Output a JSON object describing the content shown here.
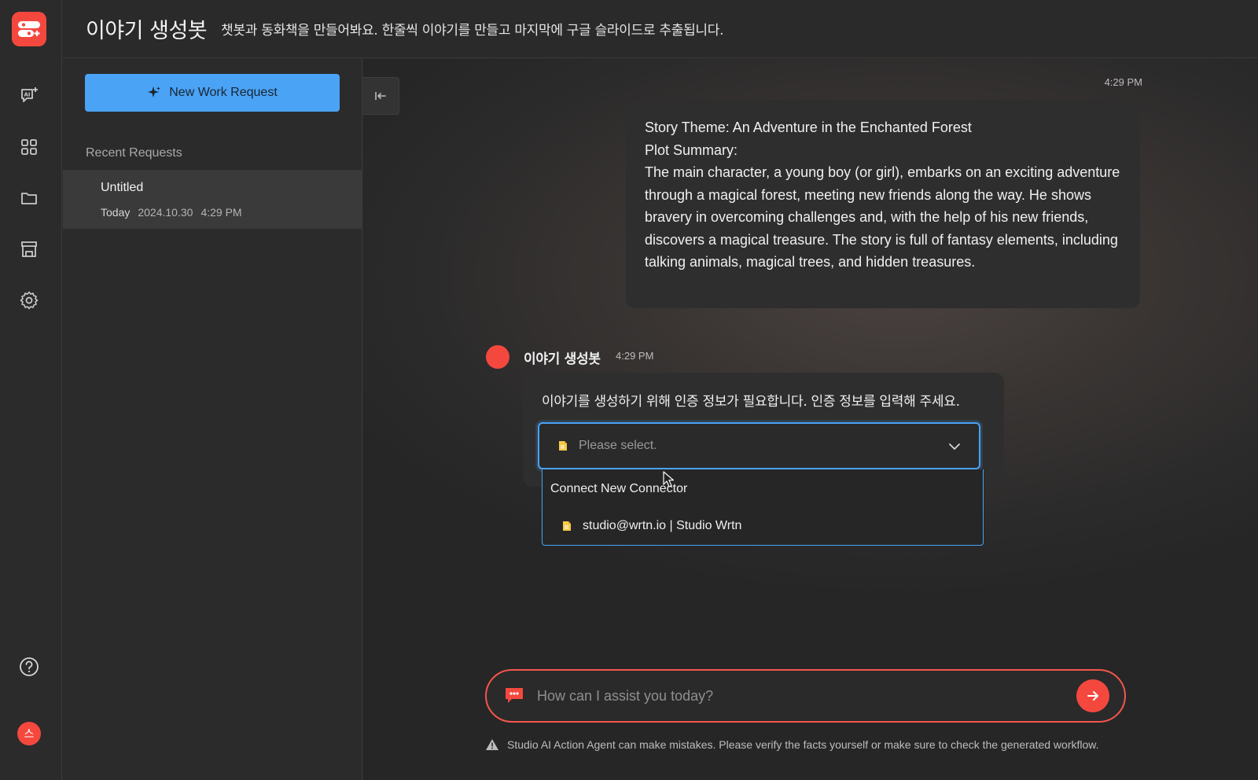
{
  "header": {
    "title": "이야기 생성봇",
    "description": "챗봇과 동화책을 만들어봐요. 한줄씩 이야기를 만들고 마지막에 구글 슬라이드로 추출됩니다."
  },
  "rail": {
    "avatar_initial": "스",
    "icons": [
      "ai-chat-icon",
      "grid-icon",
      "folder-icon",
      "store-icon",
      "gear-icon",
      "help-icon"
    ]
  },
  "sidebar": {
    "new_request_label": "New Work Request",
    "recent_label": "Recent Requests",
    "recent_items": [
      {
        "title": "Untitled",
        "day": "Today",
        "date": "2024.10.30",
        "time": "4:29 PM"
      }
    ]
  },
  "chat": {
    "user_message": {
      "time": "4:29 PM",
      "lines": [
        "Story Theme: An Adventure in the Enchanted Forest",
        "Plot Summary:",
        "The main character, a young boy (or girl), embarks on an exciting adventure through a magical forest, meeting new friends along the way. He shows bravery in overcoming challenges and, with the help of his new friends, discovers a magical treasure. The story is full of fantasy elements, including talking animals, magical trees, and hidden treasures."
      ]
    },
    "bot_message": {
      "name": "이야기 생성봇",
      "time": "4:29 PM",
      "text": "이야기를 생성하기 위해 인증 정보가 필요합니다. 인증 정보를 입력해 주세요.",
      "select": {
        "placeholder": "Please select.",
        "options": [
          {
            "label": "Connect New Connector"
          },
          {
            "label": "studio@wrtn.io | Studio Wrtn"
          }
        ]
      }
    }
  },
  "composer": {
    "placeholder": "How can I assist you today?"
  },
  "disclaimer": "Studio AI Action Agent can make mistakes. Please verify the facts yourself or make sure to check the generated workflow.",
  "colors": {
    "accent_red": "#f4483f",
    "accent_blue": "#4aa3f5",
    "background": "#2b2b2b"
  }
}
